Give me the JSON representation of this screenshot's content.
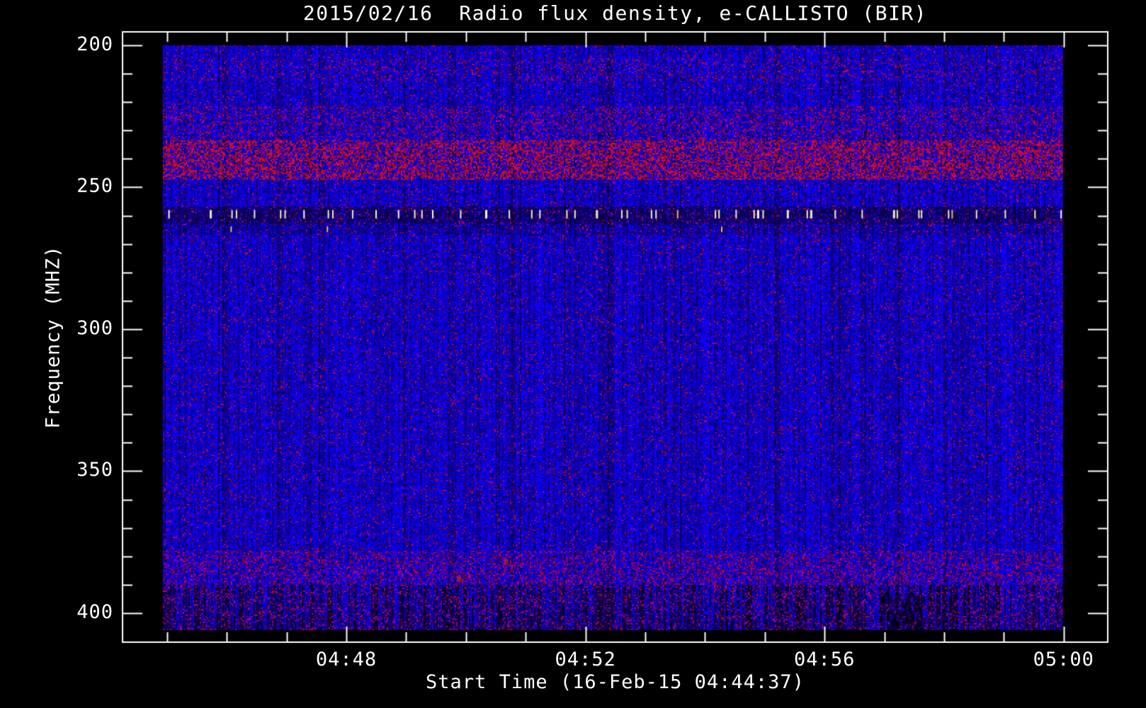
{
  "chart_data": {
    "type": "heatmap",
    "title": "2015/02/16  Radio flux density, e-CALLISTO (BIR)",
    "xlabel": "Start Time (16-Feb-15 04:44:37)",
    "ylabel": "Frequency (MHZ)",
    "x_start_time": "04:44:37",
    "x_end_time": "05:00:00",
    "x_major_ticks": [
      {
        "minute": 48,
        "label": "04:48"
      },
      {
        "minute": 52,
        "label": "04:52"
      },
      {
        "minute": 56,
        "label": "04:56"
      },
      {
        "minute": 60,
        "label": "05:00"
      }
    ],
    "x_minor_tick_minutes": [
      45,
      46,
      47,
      48,
      49,
      50,
      51,
      52,
      53,
      54,
      55,
      56,
      57,
      58,
      59,
      60
    ],
    "y_major_ticks": [
      200,
      250,
      300,
      350,
      400
    ],
    "y_minor_step": 10,
    "y_range_mhz": [
      200,
      406
    ],
    "grid": false,
    "legend": false,
    "colors": {
      "background": "#000000",
      "frame": "#FFFFFF",
      "base_blue": "#1414E8",
      "bright_blue": "#2A2AFF",
      "dark_blue": "#0000A8",
      "purple_speck": "#5A14AA",
      "red_speck": "#8C1E3C",
      "red_band": "#BE2828",
      "stripe_dark": "#04040E",
      "dash_pale": "#F2ECB4",
      "dash_bright": "#FFF8D8",
      "dash_orange": "#F0B24A"
    },
    "bands": [
      {
        "name": "faint-red-top",
        "freq": [
          204,
          212
        ],
        "red_density": 0.1
      },
      {
        "name": "mild-red-band",
        "freq": [
          221,
          233
        ],
        "red_density": 0.22
      },
      {
        "name": "strong-red-rfi-band",
        "freq": [
          233,
          247
        ],
        "red_density": 0.45
      },
      {
        "name": "dark-channel-260",
        "freq": [
          256.5,
          262.5
        ],
        "darken": 0.5
      },
      {
        "name": "dark-channel-260-tail",
        "freq": [
          262.5,
          266.5
        ],
        "darken": 0.22
      },
      {
        "name": "mild-red-low",
        "freq": [
          378,
          390
        ],
        "red_density": 0.25
      },
      {
        "name": "dark-striped-bottom",
        "freq": [
          390,
          406
        ],
        "stripe": 0.5,
        "red_density": 0.1
      }
    ],
    "dash_row": {
      "freq": 259.5,
      "positions_frac": [
        0.006,
        0.052,
        0.076,
        0.081,
        0.101,
        0.13,
        0.135,
        0.156,
        0.183,
        0.188,
        0.21,
        0.236,
        0.261,
        0.279,
        0.287,
        0.299,
        0.33,
        0.358,
        0.384,
        0.409,
        0.418,
        0.448,
        0.457,
        0.481,
        0.509,
        0.515,
        0.542,
        0.547,
        0.571,
        0.613,
        0.617,
        0.636,
        0.656,
        0.66,
        0.666,
        0.693,
        0.715,
        0.719,
        0.746,
        0.776,
        0.811,
        0.815,
        0.839,
        0.842,
        0.872,
        0.876,
        0.903,
        0.935,
        0.968,
        0.997
      ]
    },
    "sub_dashes": {
      "freq": 264.8,
      "positions_frac": [
        0.075,
        0.182,
        0.62
      ]
    },
    "features": [
      {
        "type": "dark-patch",
        "time_frac": [
          0.795,
          0.845
        ],
        "freq": [
          392,
          406
        ]
      },
      {
        "type": "red-dot",
        "time_frac": 0.379,
        "freq": 381
      },
      {
        "type": "red-dot",
        "time_frac": 0.327,
        "freq": 387
      }
    ]
  }
}
